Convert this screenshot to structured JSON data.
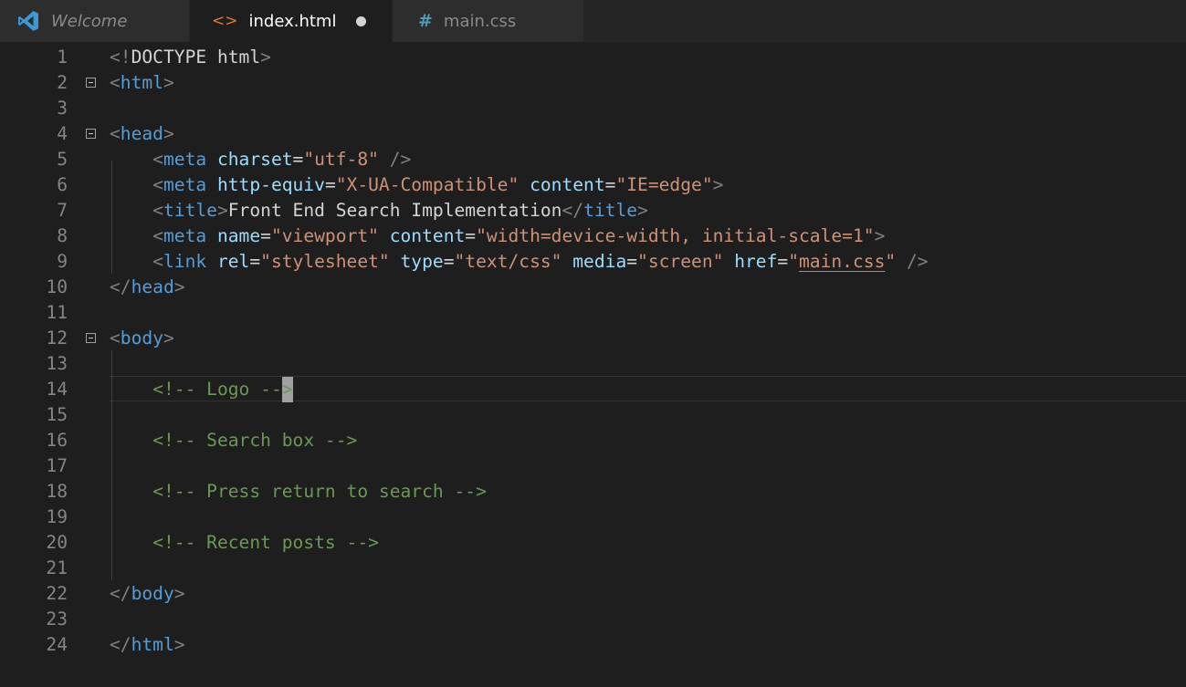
{
  "tabs": [
    {
      "label": "Welcome",
      "icon": "vscode-logo-icon",
      "active": false
    },
    {
      "label": "index.html",
      "icon": "html-file-icon",
      "icon_glyph": "<>",
      "active": true,
      "unsaved": true
    },
    {
      "label": "main.css",
      "icon": "css-file-icon",
      "icon_glyph": "#",
      "active": false
    }
  ],
  "editor": {
    "cursor_line": 14,
    "lines": [
      {
        "n": "1",
        "tokens": [
          {
            "t": "<!",
            "c": "punc"
          },
          {
            "t": "DOCTYPE html",
            "c": "txt"
          },
          {
            "t": ">",
            "c": "punc"
          }
        ]
      },
      {
        "n": "2",
        "fold": true,
        "tokens": [
          {
            "t": "<",
            "c": "punc"
          },
          {
            "t": "html",
            "c": "tag"
          },
          {
            "t": ">",
            "c": "punc"
          }
        ]
      },
      {
        "n": "3",
        "tokens": []
      },
      {
        "n": "4",
        "fold": true,
        "tokens": [
          {
            "t": "<",
            "c": "punc"
          },
          {
            "t": "head",
            "c": "tag"
          },
          {
            "t": ">",
            "c": "punc"
          }
        ]
      },
      {
        "n": "5",
        "tokens": [
          {
            "t": "    ",
            "c": "txt"
          },
          {
            "t": "<",
            "c": "punc"
          },
          {
            "t": "meta",
            "c": "tag"
          },
          {
            "t": " ",
            "c": "txt"
          },
          {
            "t": "charset",
            "c": "attr"
          },
          {
            "t": "=",
            "c": "txt"
          },
          {
            "t": "\"utf-8\"",
            "c": "str"
          },
          {
            "t": " />",
            "c": "punc"
          }
        ]
      },
      {
        "n": "6",
        "tokens": [
          {
            "t": "    ",
            "c": "txt"
          },
          {
            "t": "<",
            "c": "punc"
          },
          {
            "t": "meta",
            "c": "tag"
          },
          {
            "t": " ",
            "c": "txt"
          },
          {
            "t": "http-equiv",
            "c": "attr"
          },
          {
            "t": "=",
            "c": "txt"
          },
          {
            "t": "\"X-UA-Compatible\"",
            "c": "str"
          },
          {
            "t": " ",
            "c": "txt"
          },
          {
            "t": "content",
            "c": "attr"
          },
          {
            "t": "=",
            "c": "txt"
          },
          {
            "t": "\"IE=edge\"",
            "c": "str"
          },
          {
            "t": ">",
            "c": "punc"
          }
        ]
      },
      {
        "n": "7",
        "tokens": [
          {
            "t": "    ",
            "c": "txt"
          },
          {
            "t": "<",
            "c": "punc"
          },
          {
            "t": "title",
            "c": "tag"
          },
          {
            "t": ">",
            "c": "punc"
          },
          {
            "t": "Front End Search Implementation",
            "c": "txt"
          },
          {
            "t": "</",
            "c": "punc"
          },
          {
            "t": "title",
            "c": "tag"
          },
          {
            "t": ">",
            "c": "punc"
          }
        ]
      },
      {
        "n": "8",
        "tokens": [
          {
            "t": "    ",
            "c": "txt"
          },
          {
            "t": "<",
            "c": "punc"
          },
          {
            "t": "meta",
            "c": "tag"
          },
          {
            "t": " ",
            "c": "txt"
          },
          {
            "t": "name",
            "c": "attr"
          },
          {
            "t": "=",
            "c": "txt"
          },
          {
            "t": "\"viewport\"",
            "c": "str"
          },
          {
            "t": " ",
            "c": "txt"
          },
          {
            "t": "content",
            "c": "attr"
          },
          {
            "t": "=",
            "c": "txt"
          },
          {
            "t": "\"width=device-width, initial-scale=1\"",
            "c": "str"
          },
          {
            "t": ">",
            "c": "punc"
          }
        ]
      },
      {
        "n": "9",
        "tokens": [
          {
            "t": "    ",
            "c": "txt"
          },
          {
            "t": "<",
            "c": "punc"
          },
          {
            "t": "link",
            "c": "tag"
          },
          {
            "t": " ",
            "c": "txt"
          },
          {
            "t": "rel",
            "c": "attr"
          },
          {
            "t": "=",
            "c": "txt"
          },
          {
            "t": "\"stylesheet\"",
            "c": "str"
          },
          {
            "t": " ",
            "c": "txt"
          },
          {
            "t": "type",
            "c": "attr"
          },
          {
            "t": "=",
            "c": "txt"
          },
          {
            "t": "\"text/css\"",
            "c": "str"
          },
          {
            "t": " ",
            "c": "txt"
          },
          {
            "t": "media",
            "c": "attr"
          },
          {
            "t": "=",
            "c": "txt"
          },
          {
            "t": "\"screen\"",
            "c": "str"
          },
          {
            "t": " ",
            "c": "txt"
          },
          {
            "t": "href",
            "c": "attr"
          },
          {
            "t": "=",
            "c": "txt"
          },
          {
            "t": "\"",
            "c": "str"
          },
          {
            "t": "main.css",
            "c": "str",
            "link": true
          },
          {
            "t": "\"",
            "c": "str"
          },
          {
            "t": " />",
            "c": "punc"
          }
        ]
      },
      {
        "n": "10",
        "tokens": [
          {
            "t": "</",
            "c": "punc"
          },
          {
            "t": "head",
            "c": "tag"
          },
          {
            "t": ">",
            "c": "punc"
          }
        ]
      },
      {
        "n": "11",
        "tokens": []
      },
      {
        "n": "12",
        "fold": true,
        "tokens": [
          {
            "t": "<",
            "c": "punc"
          },
          {
            "t": "body",
            "c": "tag"
          },
          {
            "t": ">",
            "c": "punc"
          }
        ]
      },
      {
        "n": "13",
        "tokens": []
      },
      {
        "n": "14",
        "tokens": [
          {
            "t": "    ",
            "c": "txt"
          },
          {
            "t": "<!-- Logo --",
            "c": "cmt"
          },
          {
            "t": ">",
            "c": "cmt",
            "cursor": true
          }
        ]
      },
      {
        "n": "15",
        "tokens": []
      },
      {
        "n": "16",
        "tokens": [
          {
            "t": "    ",
            "c": "txt"
          },
          {
            "t": "<!-- Search box -->",
            "c": "cmt"
          }
        ]
      },
      {
        "n": "17",
        "tokens": []
      },
      {
        "n": "18",
        "tokens": [
          {
            "t": "    ",
            "c": "txt"
          },
          {
            "t": "<!-- Press return to search -->",
            "c": "cmt"
          }
        ]
      },
      {
        "n": "19",
        "tokens": []
      },
      {
        "n": "20",
        "tokens": [
          {
            "t": "    ",
            "c": "txt"
          },
          {
            "t": "<!-- Recent posts -->",
            "c": "cmt"
          }
        ]
      },
      {
        "n": "21",
        "tokens": []
      },
      {
        "n": "22",
        "tokens": [
          {
            "t": "</",
            "c": "punc"
          },
          {
            "t": "body",
            "c": "tag"
          },
          {
            "t": ">",
            "c": "punc"
          }
        ]
      },
      {
        "n": "23",
        "tokens": []
      },
      {
        "n": "24",
        "tokens": [
          {
            "t": "</",
            "c": "punc"
          },
          {
            "t": "html",
            "c": "tag"
          },
          {
            "t": ">",
            "c": "punc"
          }
        ]
      }
    ]
  },
  "colors": {
    "background": "#1e1e1e",
    "tag": "#569cd6",
    "attribute": "#9cdcfe",
    "string": "#ce9178",
    "comment": "#6a9955",
    "punctuation": "#808080",
    "line_number": "#858585"
  }
}
